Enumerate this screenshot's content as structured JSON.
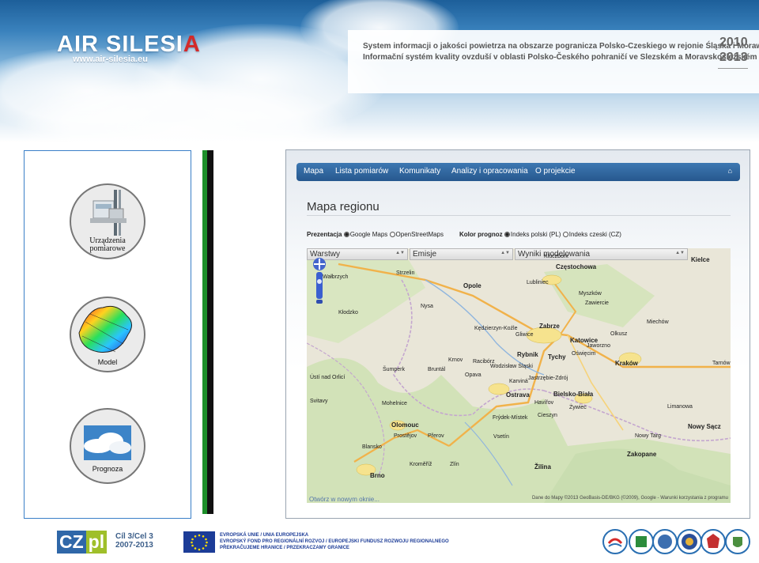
{
  "header": {
    "logo_air": "AIR SILESI",
    "logo_a": "A",
    "url": "www.air-silesia.eu",
    "title_pl": "System informacji o jakości powietrza na obszarze pogranicza Polsko-Czeskiego w rejonie Śląska i Moraw",
    "title_cz": "Informační systém kvality ovzduší v oblasti Polsko-Českého pohraničí ve Slezském a Moravskoslezském regionu",
    "year_start": "2010",
    "year_end": "2013"
  },
  "left_panel": {
    "items": [
      {
        "label_line1": "Urządzenia",
        "label_line2": "pomiarowe"
      },
      {
        "label": "Model"
      },
      {
        "label": "Prognoza"
      }
    ]
  },
  "nav": {
    "items": [
      "Mapa",
      "Lista pomiarów",
      "Komunikaty",
      "Analizy i opracowania",
      "O projekcie"
    ],
    "home_icon": "home-icon"
  },
  "page": {
    "title": "Mapa regionu",
    "prezentacja_label": "Prezentacja",
    "opt_google": "Google Maps",
    "opt_osm": "OpenStreetMaps",
    "kolor_label": "Kolor prognoz",
    "opt_pl": "Indeks polski (PL)",
    "opt_cz": "Indeks czeski (CZ)"
  },
  "map": {
    "dropdowns": [
      "Warstwy",
      "Emisje",
      "Wyniki modelowania"
    ],
    "credit": "Dane do Mapy ©2013 GeoBasis-DE/BKG (©2009), Google - Warunki korzystania z programu",
    "link": "Otwórz w nowym oknie...",
    "cities": [
      "Wałbrzych",
      "Opole",
      "Częstochowa",
      "Kielce",
      "Strzelin",
      "Nysa",
      "Kędzierzyn-Koźle",
      "Zabrze",
      "Gliwice",
      "Katowice",
      "Kraków",
      "Rybnik",
      "Tychy",
      "Racibórz",
      "Opava",
      "Ostrava",
      "Bielsko-Biała",
      "Olomouc",
      "Frýdek-Místek",
      "Nowy Sącz",
      "Zakopane",
      "Brno",
      "Żywiec",
      "Tarnów",
      "Jaworzno",
      "Oświęcim",
      "Limanowa",
      "Nowy Targ",
      "Kłodzko",
      "Prostějov",
      "Přerov",
      "Zlín",
      "Krnov",
      "Bruntál",
      "Šumperk",
      "Jastrzębie-Zdrój",
      "Žilina",
      "Havířov",
      "Karviná",
      "Kluczbork",
      "Lubliniec",
      "Myszków",
      "Zawiercie",
      "Olkusz",
      "Miechów",
      "Wodzisław Śląski",
      "Cieszyn",
      "Vsetín",
      "Kroměříž",
      "Blansko",
      "Svitavy",
      "Ústí nad Orlicí",
      "Mohelnice"
    ]
  },
  "footer": {
    "cz": "CZ",
    "pl": "pl",
    "cil_line1": "Cíl 3/Cel 3",
    "cil_line2": "2007-2013",
    "eu_line1": "EVROPSKÁ UNIE / UNIA EUROPEJSKA",
    "eu_line2": "EVROPSKÝ FOND PRO REGIONÁLNÍ ROZVOJ / EUROPEJSKI FUNDUSZ ROZWOJU REGIONALNEGO",
    "eu_line3": "PŘEKRAČUJEME HRANICE / PRZEKRACZAMY GRANICE"
  }
}
